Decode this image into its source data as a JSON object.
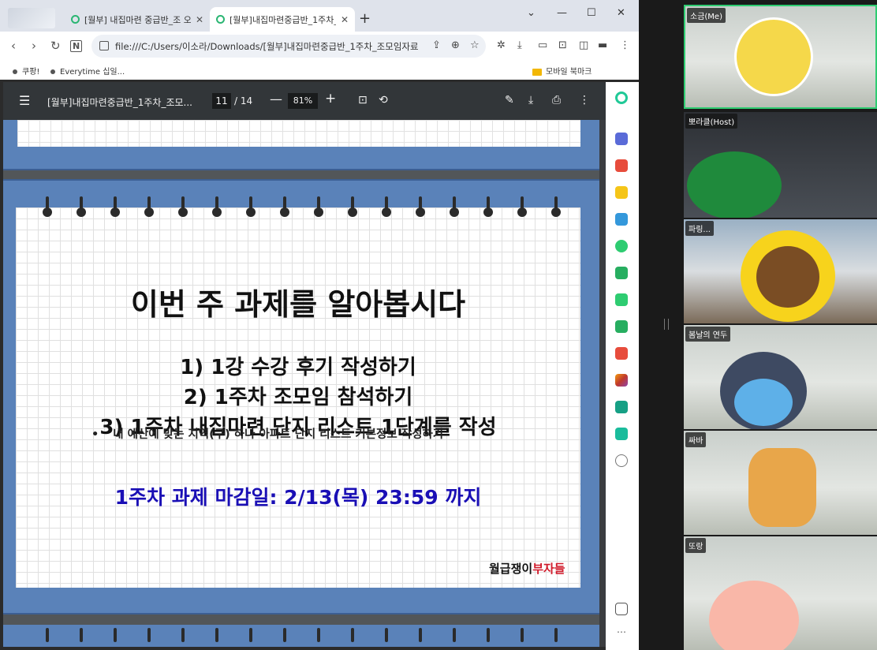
{
  "browser": {
    "tabs": [
      {
        "label": "[월부] 내집마련 중급반_조 오",
        "active": false
      },
      {
        "label": "[월부]내집마련중급반_1주차_조",
        "active": true
      }
    ],
    "new_tab": "+",
    "address": "file:///C:/Users/이소라/Downloads/[월부]내집마련중급반_1주차_조모임자료",
    "bookmarks": [
      "쿠팡!",
      "Everytime 십일..."
    ],
    "bookmark_folder": "모바일 북마크"
  },
  "pdf": {
    "title": "[월부]내집마련중급반_1주차_조모...",
    "current_page": "11",
    "total_pages": "/ 14",
    "zoom": "81%"
  },
  "slide": {
    "title": "이번 주 과제를 알아봅시다",
    "items": [
      "1)  1강 수강 후기 작성하기",
      "2)  1주차 조모임 참석하기",
      "3)  1주차 내집마련 단지 리스트 1단계를 작성"
    ],
    "bullet": "내 예산에 맞는 지역(구) 하나 아파트 단지 리스트 기본정보 작성하기",
    "bullet_mark": "•",
    "deadline": "1주차 과제 마감일: 2/13(목) 23:59 까지",
    "logo_black": "월급쟁이",
    "logo_red": "부자들"
  },
  "participants": [
    {
      "name": "소금(Me)",
      "active_speaker": true
    },
    {
      "name": "뽀라클(Host)",
      "active_speaker": false
    },
    {
      "name": "파링...",
      "active_speaker": false
    },
    {
      "name": "봄날의 연두",
      "active_speaker": false
    },
    {
      "name": "싸바",
      "active_speaker": false
    },
    {
      "name": "또랑",
      "active_speaker": false
    }
  ],
  "colors": {
    "active_speaker_border": "#2ecc71",
    "deadline_text": "#1a0fb5",
    "logo_red": "#d11a2a",
    "slide_frame": "#5a82b9"
  }
}
